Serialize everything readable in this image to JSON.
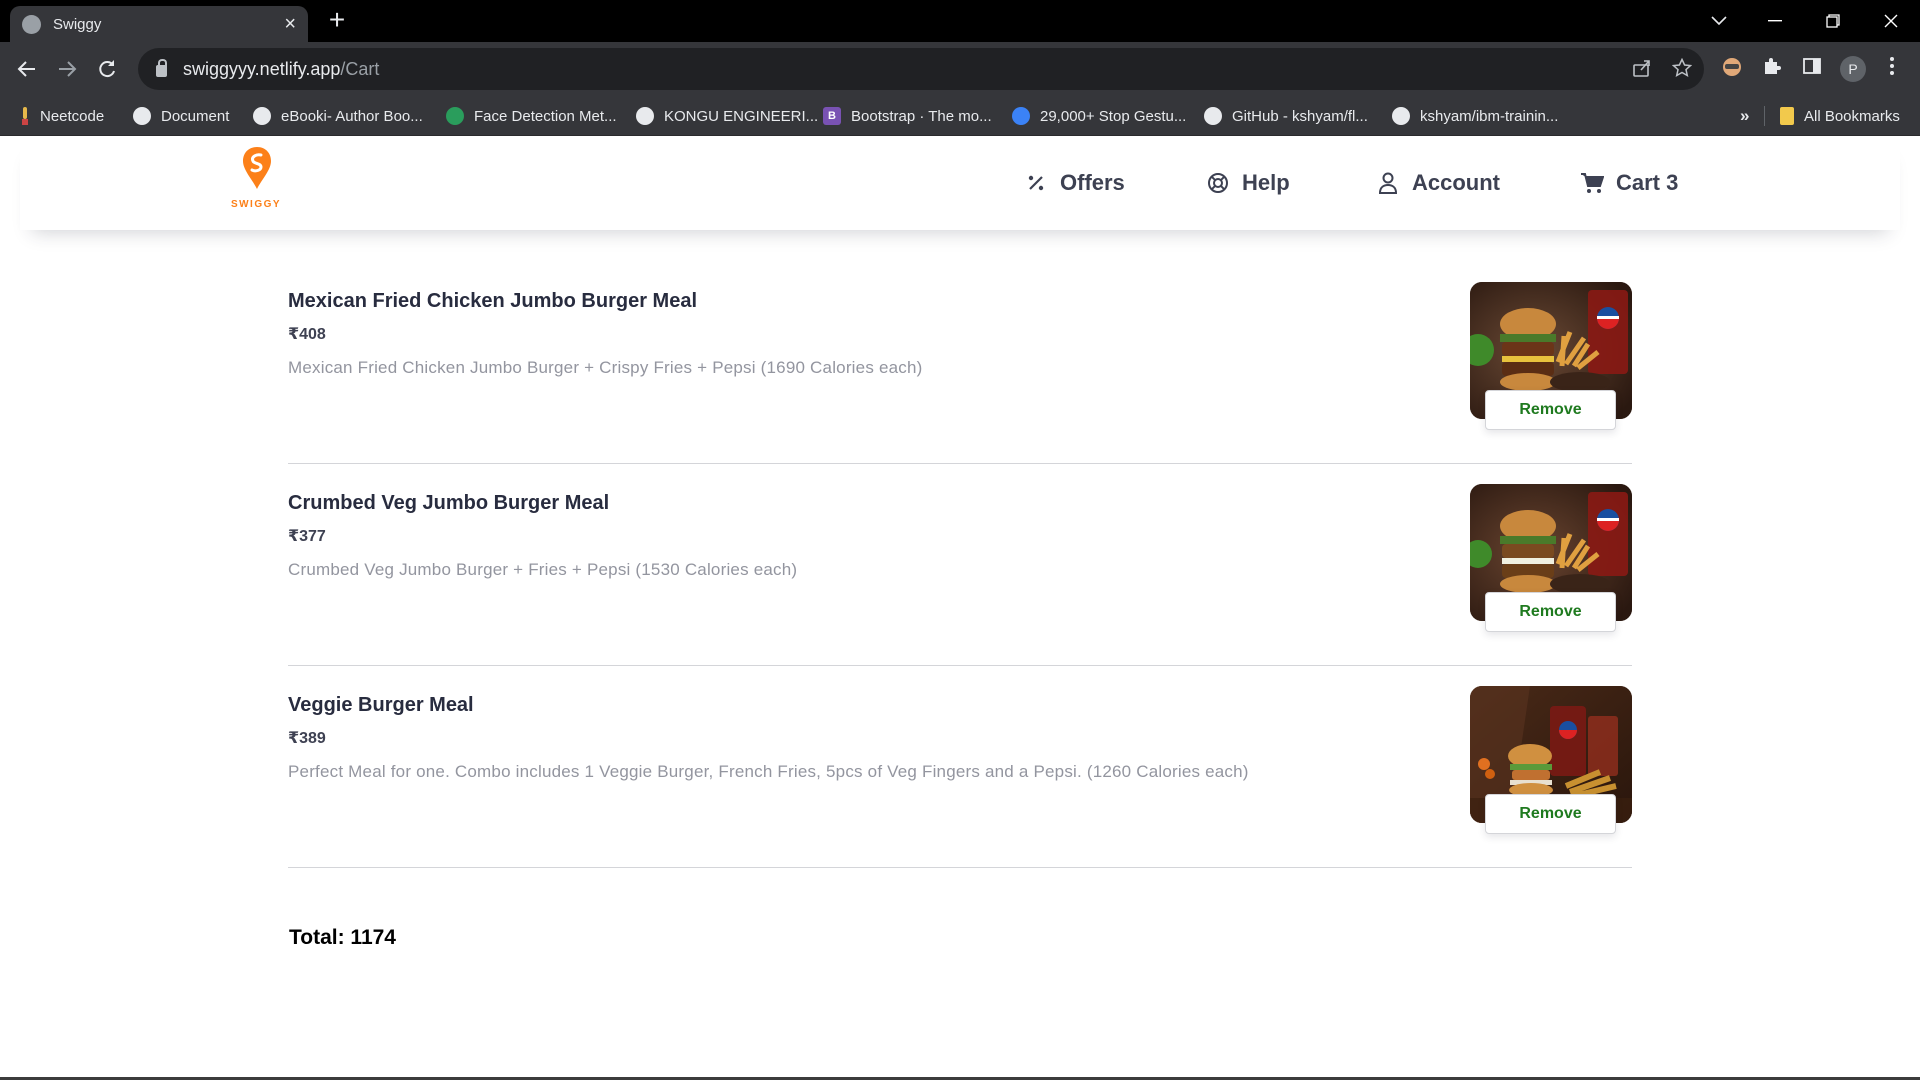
{
  "browser": {
    "tab_title": "Swiggy",
    "url_host": "swiggyyy.netlify.app",
    "url_path": "/Cart",
    "profile_initial": "P",
    "bookmarks": [
      {
        "label": "Neetcode",
        "icon": "neetcode-icon",
        "color": "#d0a040"
      },
      {
        "label": "Document",
        "icon": "globe-icon",
        "color": "#e8eaed"
      },
      {
        "label": "eBooki- Author Boo...",
        "icon": "globe-icon",
        "color": "#e8eaed"
      },
      {
        "label": "Face Detection Met...",
        "icon": "eye-icon",
        "color": "#2a9d5c"
      },
      {
        "label": "KONGU ENGINEERI...",
        "icon": "globe-icon",
        "color": "#e8eaed"
      },
      {
        "label": "Bootstrap · The mo...",
        "icon": "bootstrap-icon",
        "color": "#7952b3"
      },
      {
        "label": "29,000+ Stop Gestu...",
        "icon": "robot-icon",
        "color": "#3b82f6"
      },
      {
        "label": "GitHub - kshyam/fl...",
        "icon": "github-icon",
        "color": "#e8eaed"
      },
      {
        "label": "kshyam/ibm-trainin...",
        "icon": "github-icon",
        "color": "#e8eaed"
      }
    ],
    "overflow_label": "»",
    "all_bookmarks": "All Bookmarks"
  },
  "header": {
    "logo_text": "SWIGGY",
    "nav": {
      "offers": "Offers",
      "help": "Help",
      "account": "Account",
      "cart": "Cart 3"
    },
    "brand_color": "#fc8019"
  },
  "cart": {
    "items": [
      {
        "name": "Mexican Fried Chicken Jumbo Burger Meal",
        "price": "₹408",
        "description": "Mexican Fried Chicken Jumbo Burger + Crispy Fries + Pepsi (1690 Calories each)",
        "remove_label": "Remove"
      },
      {
        "name": "Crumbed Veg Jumbo Burger Meal",
        "price": "₹377",
        "description": "Crumbed Veg Jumbo Burger + Fries + Pepsi (1530 Calories each)",
        "remove_label": "Remove"
      },
      {
        "name": "Veggie Burger Meal",
        "price": "₹389",
        "description": "Perfect Meal for one. Combo includes 1 Veggie Burger, French Fries, 5pcs of Veg Fingers and a Pepsi. (1260 Calories each)",
        "remove_label": "Remove"
      }
    ],
    "total": "Total: 1174"
  }
}
